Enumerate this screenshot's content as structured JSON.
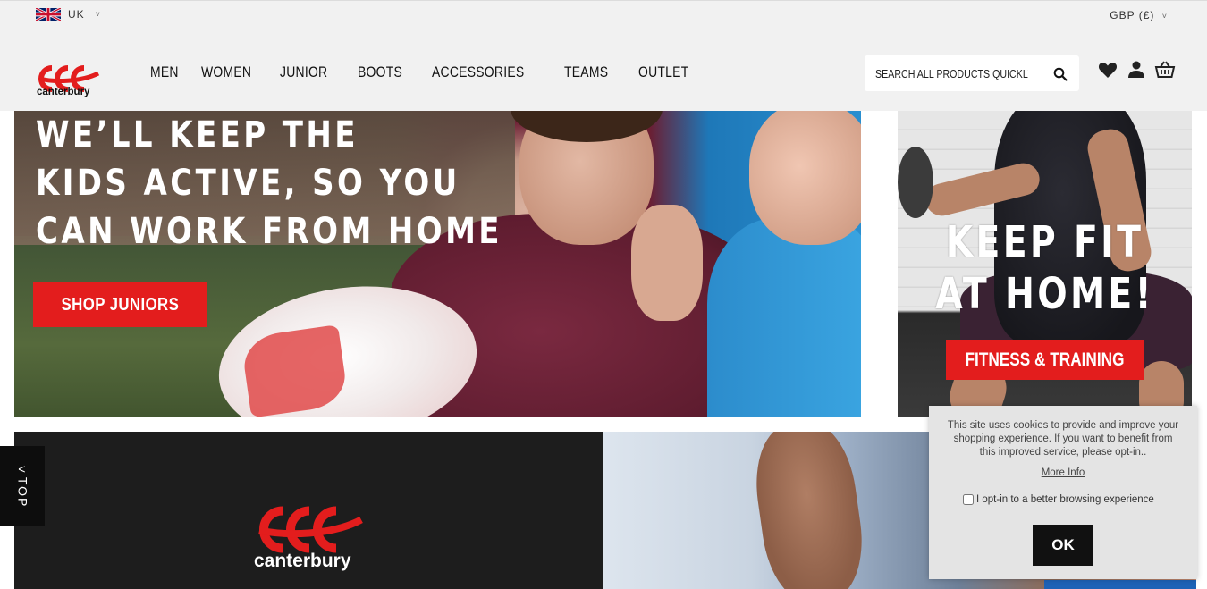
{
  "topbar": {
    "region_label": "UK",
    "currency_label": "GBP (£)",
    "caret": "˅"
  },
  "header": {
    "brand": "canterbury",
    "nav": [
      "MEN",
      "WOMEN",
      "JUNIOR",
      "BOOTS",
      "ACCESSORIES",
      "TEAMS",
      "OUTLET"
    ],
    "search_placeholder": "SEARCH ALL PRODUCTS QUICKLY AND EASILY",
    "icons": [
      "heart-icon",
      "user-icon",
      "basket-icon",
      "search-icon"
    ]
  },
  "hero": {
    "title_lines": [
      "WE’LL KEEP THE",
      "KIDS ACTIVE, SO YOU",
      "CAN WORK FROM HOME"
    ],
    "button": "SHOP JUNIORS"
  },
  "promo": {
    "title_lines": [
      "KEEP FIT",
      "AT HOME!"
    ],
    "button": "FITNESS & TRAINING"
  },
  "banner": {
    "brand": "canterbury"
  },
  "back_to_top": {
    "label": "TOP",
    "arrow": "<"
  },
  "cookie": {
    "text": "This site uses cookies to provide and improve your shopping experience. If you want to benefit from this improved service, please opt-in..",
    "more_info": "More Info",
    "opt_in_label": "I opt-in to a better browsing experience",
    "ok_label": "OK"
  },
  "colors": {
    "brand_red": "#e31d1d",
    "header_bg": "#f1f1f1",
    "dark": "#1d1d1d"
  }
}
